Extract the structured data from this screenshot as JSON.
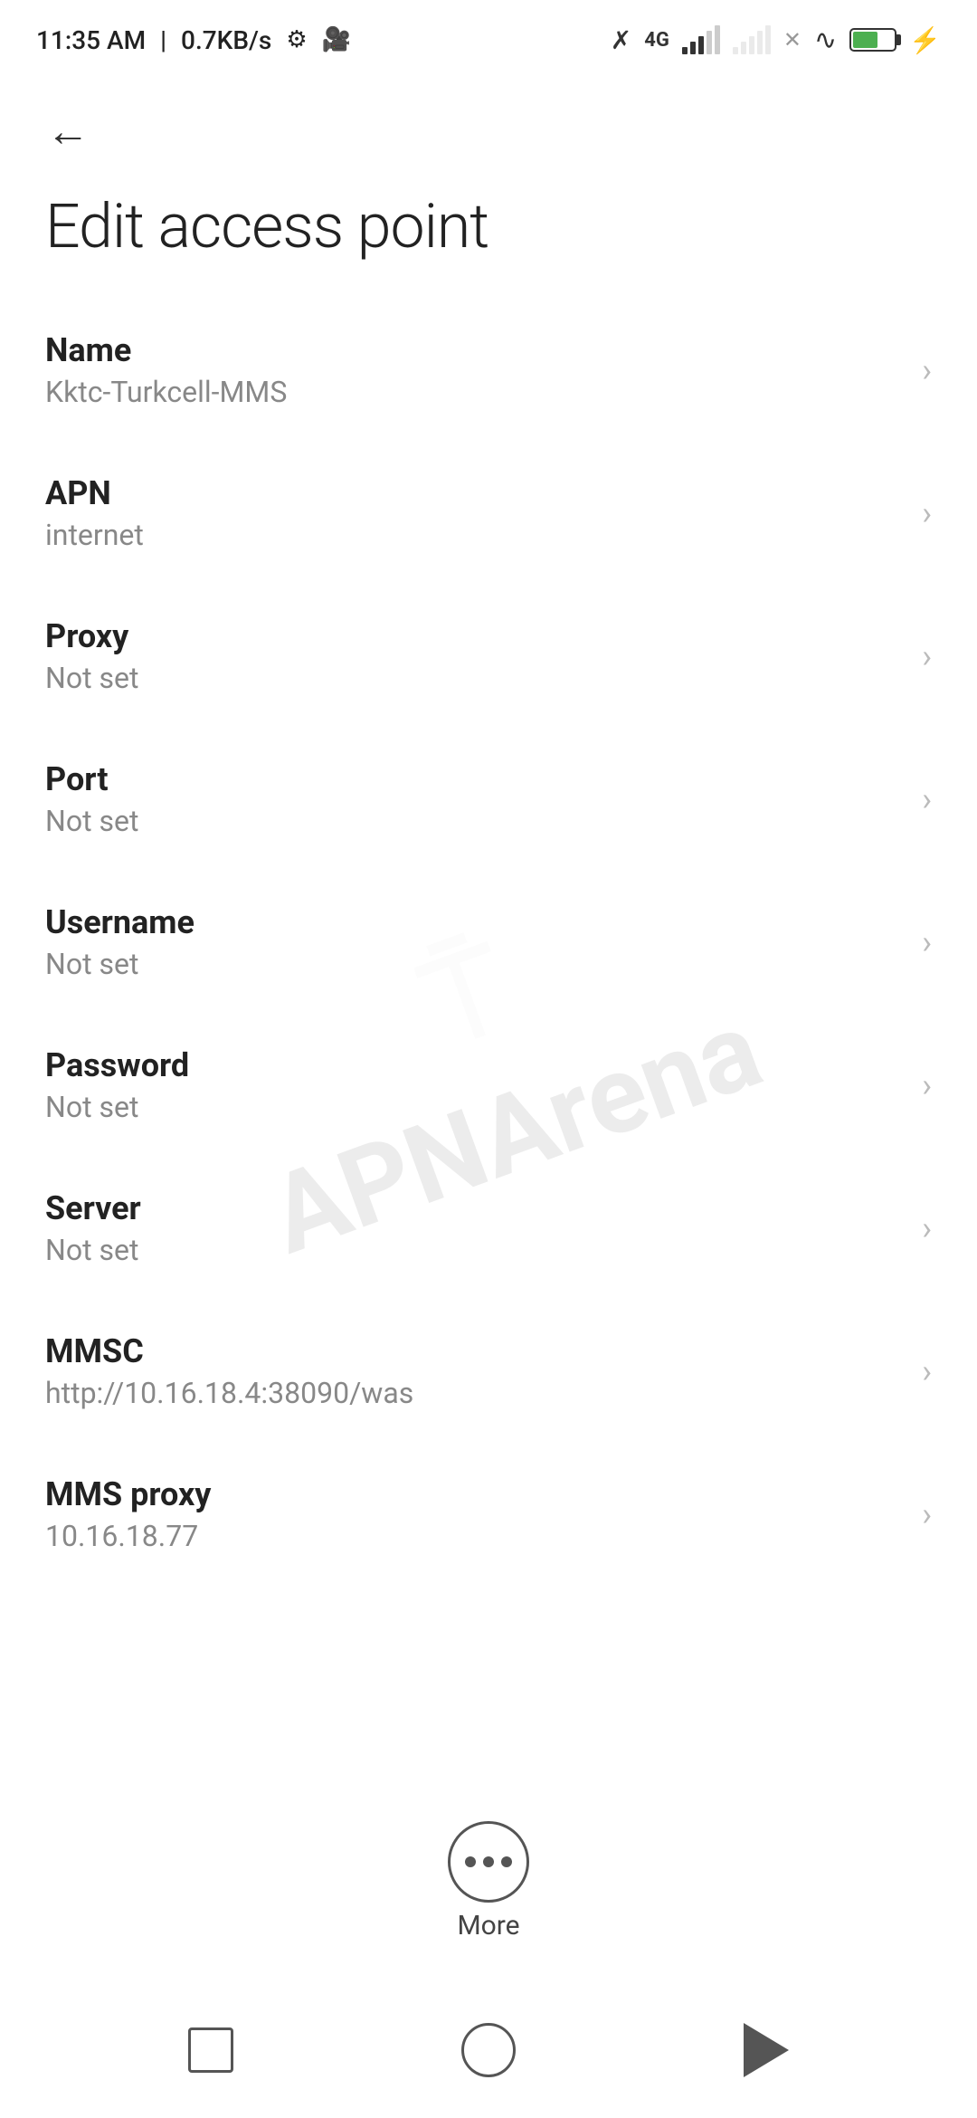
{
  "statusBar": {
    "time": "11:35 AM",
    "speed": "0.7KB/s",
    "battery": "38"
  },
  "page": {
    "title": "Edit access point",
    "backLabel": "Back"
  },
  "settings": [
    {
      "id": "name",
      "label": "Name",
      "value": "Kktc-Turkcell-MMS"
    },
    {
      "id": "apn",
      "label": "APN",
      "value": "internet"
    },
    {
      "id": "proxy",
      "label": "Proxy",
      "value": "Not set"
    },
    {
      "id": "port",
      "label": "Port",
      "value": "Not set"
    },
    {
      "id": "username",
      "label": "Username",
      "value": "Not set"
    },
    {
      "id": "password",
      "label": "Password",
      "value": "Not set"
    },
    {
      "id": "server",
      "label": "Server",
      "value": "Not set"
    },
    {
      "id": "mmsc",
      "label": "MMSC",
      "value": "http://10.16.18.4:38090/was"
    },
    {
      "id": "mms-proxy",
      "label": "MMS proxy",
      "value": "10.16.18.77"
    }
  ],
  "more": {
    "label": "More"
  },
  "watermark": "APNArena"
}
